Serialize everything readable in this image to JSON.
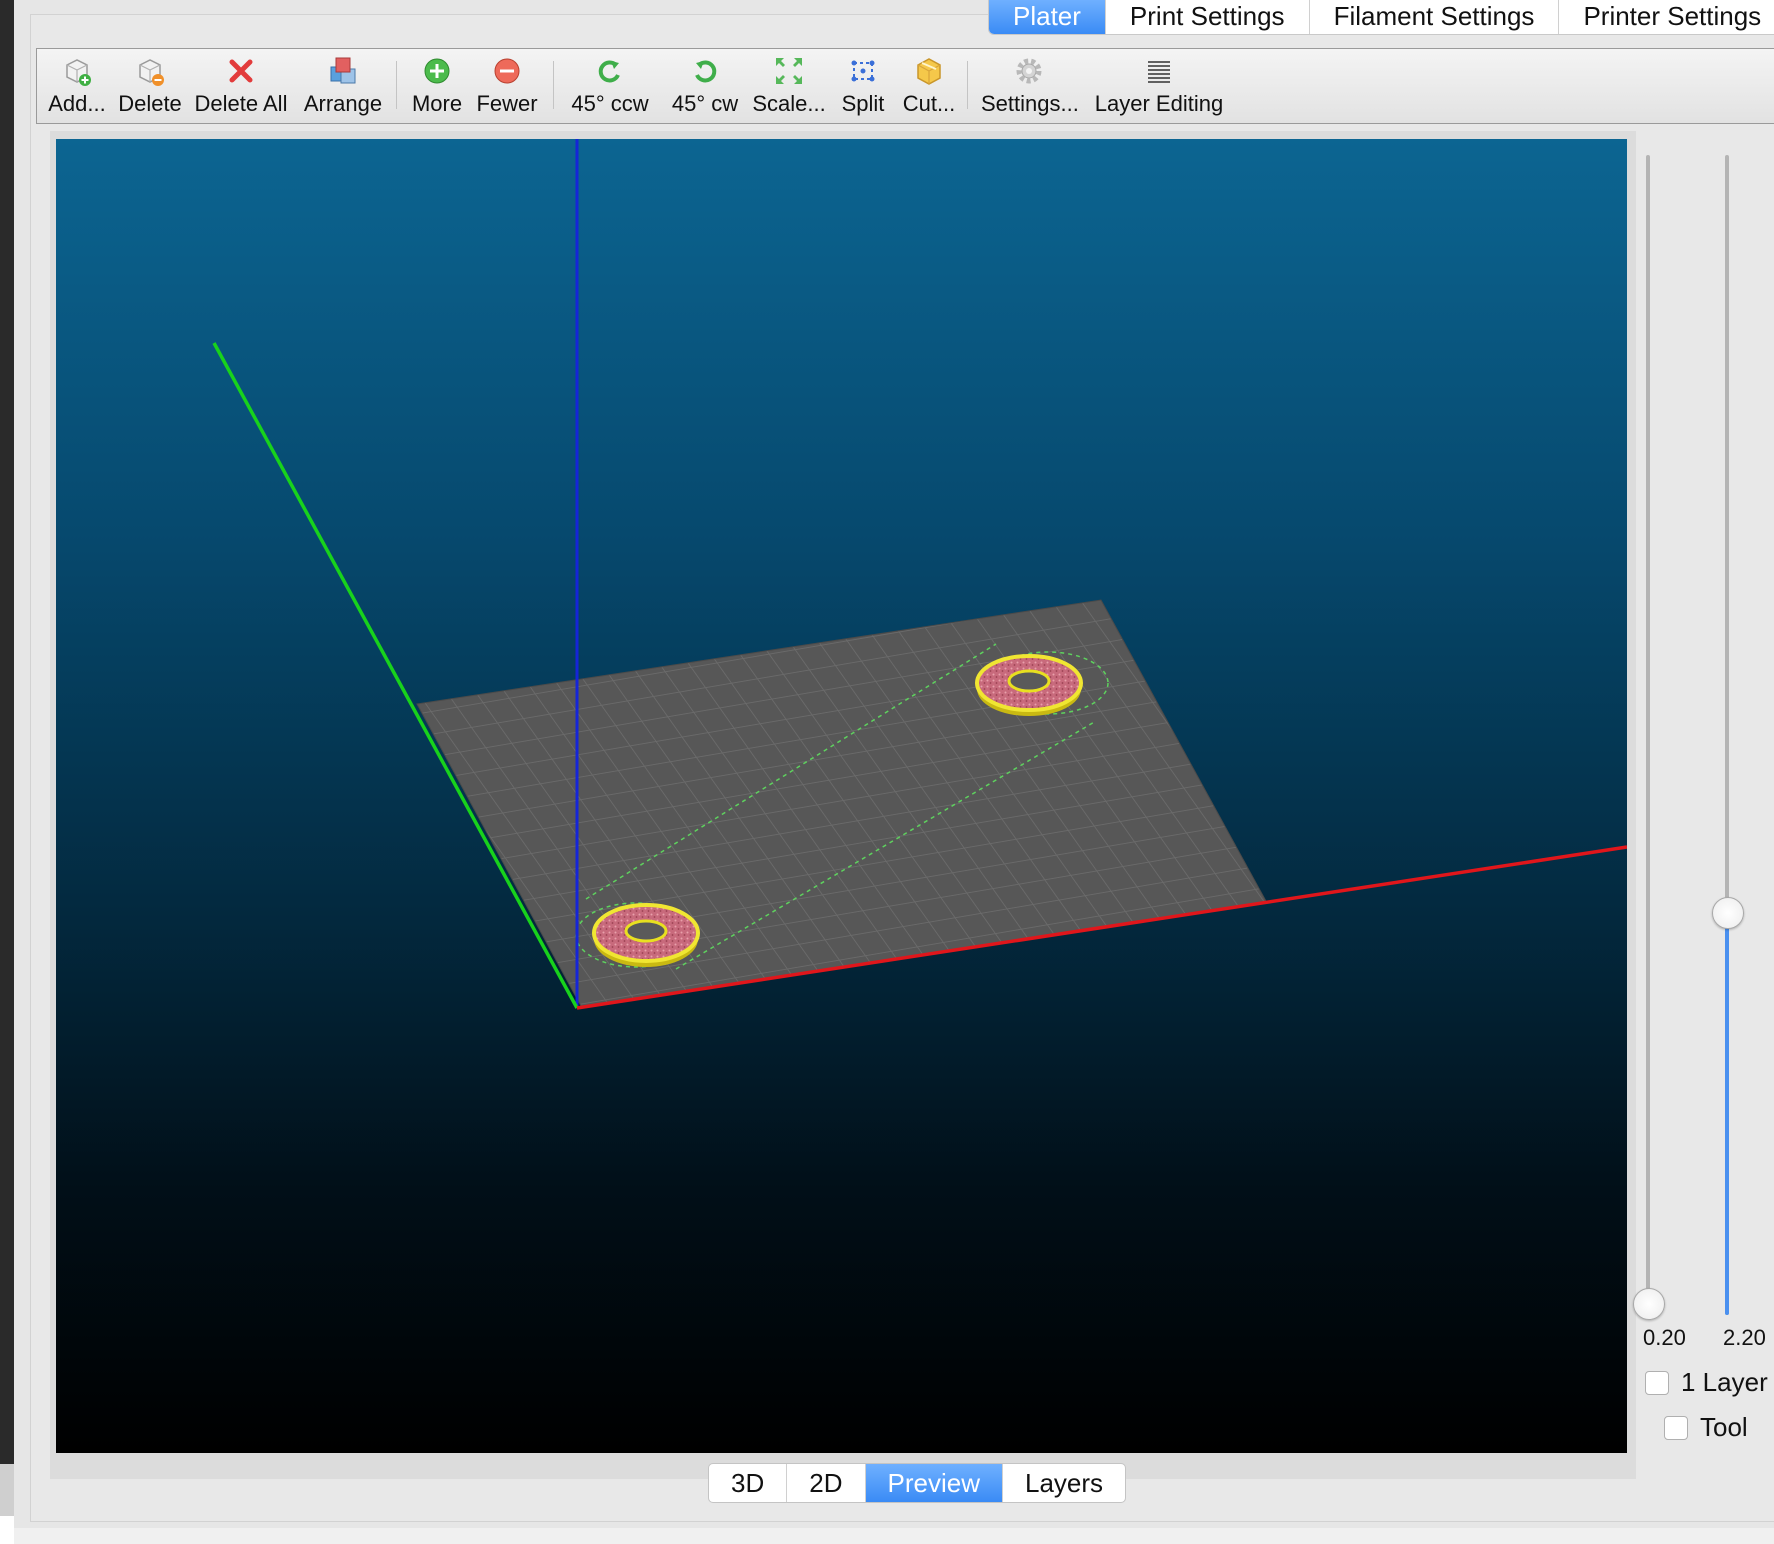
{
  "tabs": [
    {
      "label": "Plater",
      "active": true
    },
    {
      "label": "Print Settings",
      "active": false
    },
    {
      "label": "Filament Settings",
      "active": false
    },
    {
      "label": "Printer Settings",
      "active": false
    }
  ],
  "toolbar": {
    "add": "Add...",
    "delete": "Delete",
    "delete_all": "Delete All",
    "arrange": "Arrange",
    "more": "More",
    "fewer": "Fewer",
    "rotate_ccw": "45° ccw",
    "rotate_cw": "45° cw",
    "scale": "Scale...",
    "split": "Split",
    "cut": "Cut...",
    "settings": "Settings...",
    "layer_editing": "Layer Editing"
  },
  "icons": {
    "add": "cube-plus-icon",
    "delete": "cube-minus-icon",
    "delete_all": "red-x-icon",
    "arrange": "stacked-cubes-icon",
    "more": "green-plus-circle-icon",
    "fewer": "red-minus-circle-icon",
    "rotate_ccw": "rotate-ccw-icon",
    "rotate_cw": "rotate-cw-icon",
    "scale": "expand-arrows-icon",
    "split": "split-dots-icon",
    "cut": "cube-cut-icon",
    "settings": "gear-icon",
    "layer_editing": "layers-lines-icon"
  },
  "sliders": {
    "min_label": "0.20",
    "max_label": "2.20",
    "upper_level_fraction": 0.33,
    "lower_level_fraction": 0.0
  },
  "options": {
    "one_layer": "1 Layer",
    "tool": "Tool"
  },
  "view_modes": [
    {
      "label": "3D",
      "active": false
    },
    {
      "label": "2D",
      "active": false
    },
    {
      "label": "Preview",
      "active": true
    },
    {
      "label": "Layers",
      "active": false
    }
  ],
  "colors": {
    "accent": "#3a8bf5",
    "x_axis": "#e0161b",
    "y_axis": "#18d21c",
    "z_axis": "#1525d8",
    "bed": "#555555",
    "part_fill": "#c96a7a",
    "part_outline": "#e8e020",
    "skirt": "#5ed15e"
  }
}
